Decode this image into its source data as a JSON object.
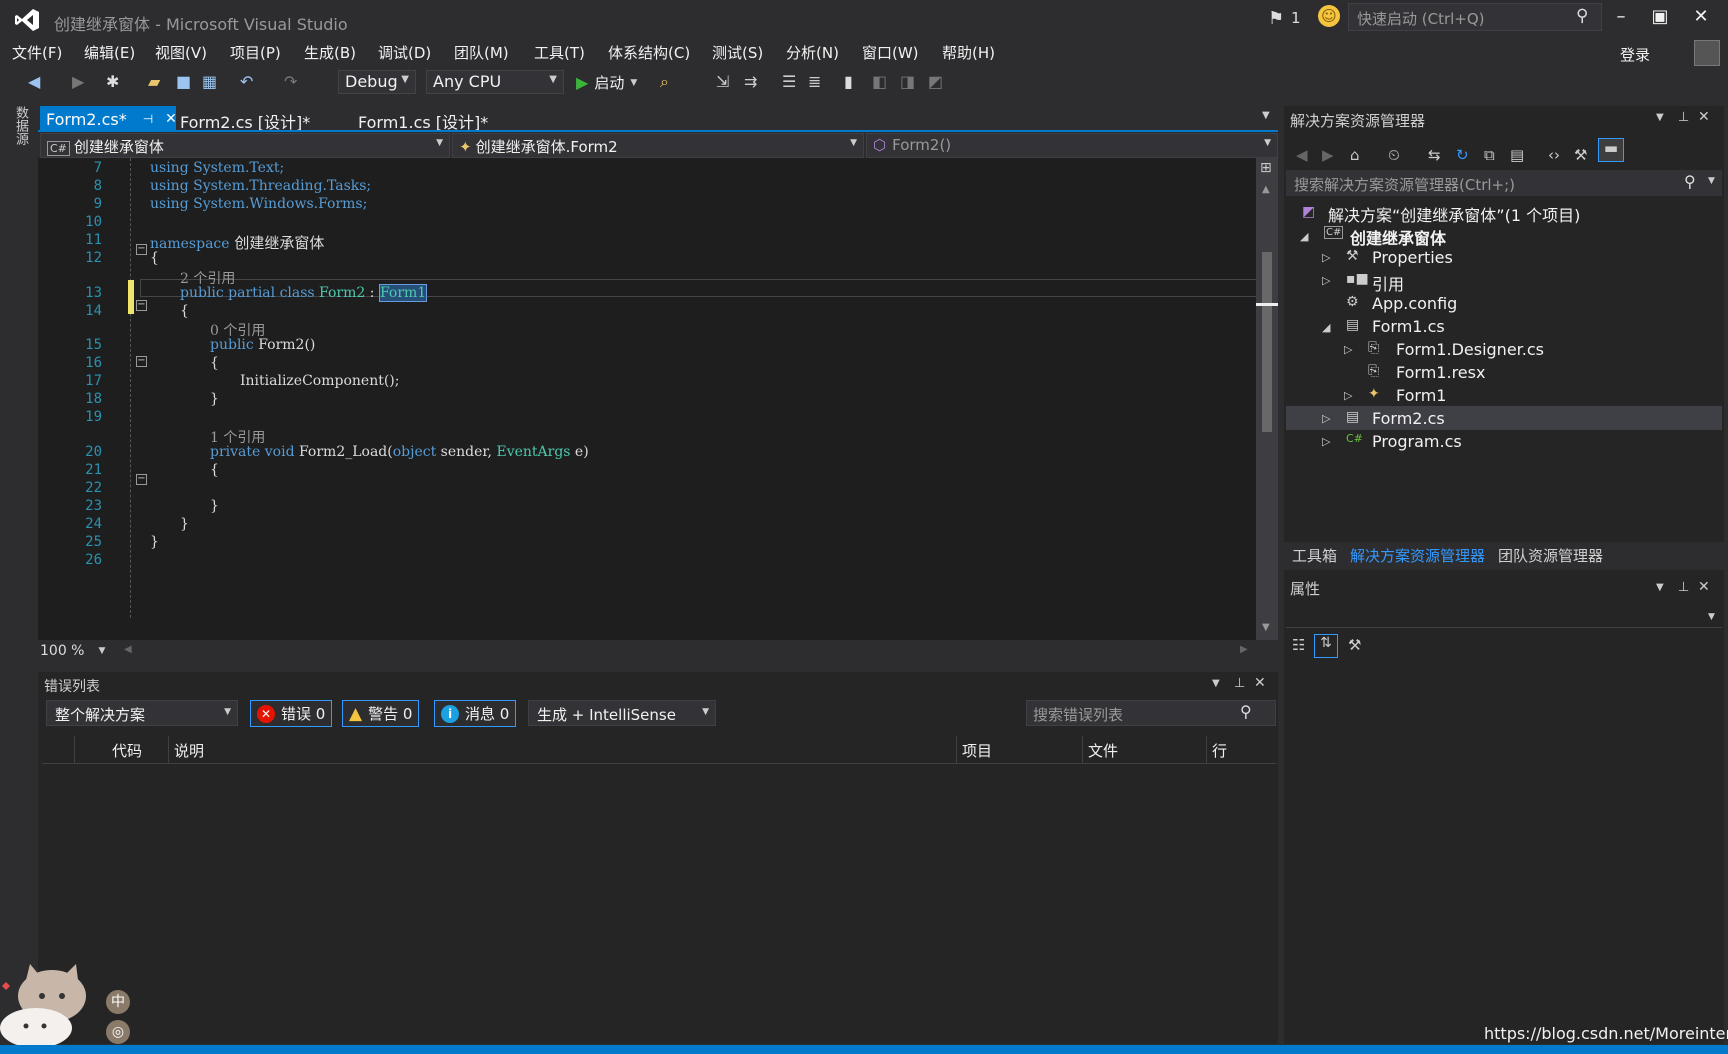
{
  "window": {
    "title": "创建继承窗体 - Microsoft Visual Studio"
  },
  "titlebar": {
    "notification_count": "1",
    "quick_launch_placeholder": "快速启动 (Ctrl+Q)"
  },
  "menu": {
    "items": [
      "文件(F)",
      "编辑(E)",
      "视图(V)",
      "项目(P)",
      "生成(B)",
      "调试(D)",
      "团队(M)",
      "工具(T)",
      "体系结构(C)",
      "测试(S)",
      "分析(N)",
      "窗口(W)",
      "帮助(H)"
    ],
    "login": "登录"
  },
  "toolbar": {
    "config": "Debug",
    "platform": "Any CPU",
    "start_label": "启动"
  },
  "sidebar": {
    "data_sources": "数据源"
  },
  "tabs": [
    "Form2.cs*",
    "Form2.cs [设计]*",
    "Form1.cs [设计]*"
  ],
  "navbar": {
    "project": "创建继承窗体",
    "class": "创建继承窗体.Form2",
    "member": "Form2()"
  },
  "editor": {
    "zoom": "100 %",
    "lines": [
      {
        "n": "7"
      },
      {
        "n": "8"
      },
      {
        "n": "9"
      },
      {
        "n": "10"
      },
      {
        "n": "11"
      },
      {
        "n": "12"
      },
      {
        "n": "13"
      },
      {
        "n": "14"
      },
      {
        "n": "15"
      },
      {
        "n": "16"
      },
      {
        "n": "17"
      },
      {
        "n": "18"
      },
      {
        "n": "19"
      },
      {
        "n": "20"
      },
      {
        "n": "21"
      },
      {
        "n": "22"
      },
      {
        "n": "23"
      },
      {
        "n": "24"
      },
      {
        "n": "25"
      },
      {
        "n": "26"
      }
    ],
    "code": {
      "l7": "using System.Text;",
      "l8": "using System.Threading.Tasks;",
      "l9": "using System.Windows.Forms;",
      "l11_kw": "namespace",
      "l11_name": " 创建继承窗体",
      "l12": "{",
      "hint13": "2 个引用",
      "l13_kw": "public partial class",
      "l13_type": " Form2",
      "l13_sep": " : ",
      "l13_base": "Form1",
      "l14": "{",
      "hint15": "0 个引用",
      "l15_kw": "public",
      "l15_name": " Form2()",
      "l16": "{",
      "l17": "InitializeComponent();",
      "l18": "}",
      "hint20": "1 个引用",
      "l20_kw": "private void",
      "l20_name": " Form2_Load(",
      "l20_kw2": "object",
      "l20_p1": " sender, ",
      "l20_type": "EventArgs",
      "l20_p2": " e)",
      "l21": "{",
      "l23": "}",
      "l24": "}",
      "l25": "}"
    }
  },
  "errorlist": {
    "title": "错误列表",
    "scope": "整个解决方案",
    "errors": "错误 0",
    "warnings": "警告 0",
    "messages": "消息 0",
    "source": "生成 + IntelliSense",
    "search_placeholder": "搜索错误列表",
    "columns": [
      "代码",
      "说明",
      "项目",
      "文件",
      "行"
    ]
  },
  "solution_explorer": {
    "title": "解决方案资源管理器",
    "search_placeholder": "搜索解决方案资源管理器(Ctrl+;)",
    "items": [
      {
        "label": "解决方案“创建继承窗体”(1 个项目)"
      },
      {
        "label": "创建继承窗体"
      },
      {
        "label": "Properties"
      },
      {
        "label": "引用"
      },
      {
        "label": "App.config"
      },
      {
        "label": "Form1.cs"
      },
      {
        "label": "Form1.Designer.cs"
      },
      {
        "label": "Form1.resx"
      },
      {
        "label": "Form1"
      },
      {
        "label": "Form2.cs"
      },
      {
        "label": "Program.cs"
      }
    ]
  },
  "bottom_tabs": [
    "工具箱",
    "解决方案资源管理器",
    "团队资源管理器"
  ],
  "properties": {
    "title": "属性"
  },
  "ime": {
    "label": "中"
  },
  "watermark": "https://blog.csdn.net/Moreinterest",
  "colors": {
    "accent": "#007acc",
    "keyword": "#569cd6",
    "type": "#4ec9b0",
    "line_number": "#2b91af"
  }
}
